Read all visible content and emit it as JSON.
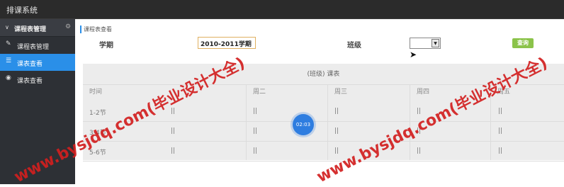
{
  "app": {
    "title": "排课系统"
  },
  "sidebar": {
    "section": {
      "label": "课程表管理"
    },
    "items": [
      {
        "label": "课程表管理",
        "icon": "pencil-icon"
      },
      {
        "label": "课表查看",
        "icon": "list-icon",
        "active": true
      },
      {
        "label": "课表查看",
        "icon": "globe-icon"
      }
    ]
  },
  "breadcrumb": "课程表查看",
  "filters": {
    "term_label": "学期",
    "term_value": "2010-2011学期",
    "class_label": "班级",
    "class_value": "",
    "query_button": "查询"
  },
  "schedule": {
    "caption": "(班级) 课表",
    "headers": [
      "时间",
      "周二",
      "周三",
      "周四",
      "周五"
    ],
    "rows": [
      {
        "time": "1-2节",
        "cells": [
          "||",
          "||",
          "||",
          "||",
          "||"
        ]
      },
      {
        "time": "3-4节",
        "cells": [
          "||",
          "||",
          "||",
          "||",
          "||"
        ]
      },
      {
        "time": "5-6节",
        "cells": [
          "||",
          "||",
          "||",
          "||",
          "||"
        ]
      }
    ]
  },
  "timer": "02:03",
  "watermarks": [
    "www.bysjdq.com(毕业设计大全)",
    "www.bysjdq.com(毕业设计大全)"
  ],
  "colors": {
    "accent": "#2a8fe8",
    "query_button": "#8bc34a",
    "watermark": "#d21f1f"
  }
}
